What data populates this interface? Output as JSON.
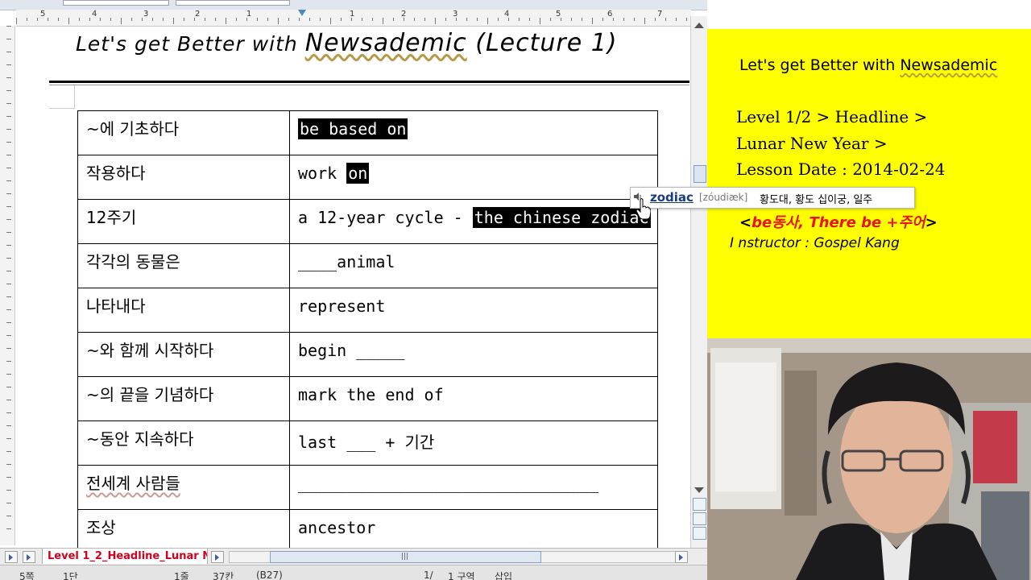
{
  "document": {
    "title_part1": "Let's get Better with ",
    "title_brand": "Newsademic",
    "title_part2": " (Lecture 1)",
    "rows": [
      {
        "kr": "~에 기초하다",
        "en": "",
        "en_hl": "be based on ",
        "en_after": ""
      },
      {
        "kr": "작용하다",
        "en": "work ",
        "en_hl": "on",
        "en_after": ""
      },
      {
        "kr": "12주기",
        "en": "a 12-year cycle - ",
        "en_hl": "the chinese zodiac",
        "en_after": ""
      },
      {
        "kr": "각각의 동물은",
        "en": "____animal",
        "en_hl": "",
        "en_after": ""
      },
      {
        "kr": "나타내다",
        "en": "represent",
        "en_hl": "",
        "en_after": ""
      },
      {
        "kr": "~와 함께 시작하다",
        "en": "begin _____",
        "en_hl": "",
        "en_after": ""
      },
      {
        "kr": "~의 끝을 기념하다",
        "en": "mark the end of",
        "en_hl": "",
        "en_after": ""
      },
      {
        "kr": "~동안 지속하다",
        "en": "last ___ + 기간",
        "en_hl": "",
        "en_after": ""
      },
      {
        "kr": "전세계 사람들",
        "en": "_______________________________",
        "en_hl": "",
        "en_after": ""
      },
      {
        "kr": "조상",
        "en": "ancestor",
        "en_hl": "",
        "en_after": ""
      }
    ]
  },
  "ruler": {
    "numbers": [
      "5",
      "4",
      "3",
      "2",
      "1",
      "1",
      "2",
      "3",
      "4",
      "5",
      "6",
      "7"
    ]
  },
  "bottom_tab": {
    "label": "Level 1_2_Headline_Lunar N"
  },
  "statusbar": {
    "page": "5쪽",
    "section": "1단",
    "line": "1줄",
    "column": "37칸",
    "code": "(B27)",
    "pages": "1/",
    "language": "1 구역",
    "mode": "삽입"
  },
  "sidepanel": {
    "title_part1": "Let's get Better with ",
    "title_brand": "Newsademic",
    "level": "Level 1/2 > Headline >",
    "topic": "Lunar New Year >",
    "date": "Lesson Date : 2014-02-24",
    "grammar_open": "<",
    "grammar": "be동사, There be +주어",
    "grammar_close": ">",
    "instructor": "I nstructor : Gospel Kang"
  },
  "tooltip": {
    "word": "zodiac",
    "pronunciation": "[zóudiæk]",
    "meaning": "황도대, 황도 십이궁, 일주"
  },
  "colors": {
    "panel": "#ffff00",
    "grammar": "#e8141b",
    "tab_label": "#d1001c",
    "highlight": "#000000"
  }
}
